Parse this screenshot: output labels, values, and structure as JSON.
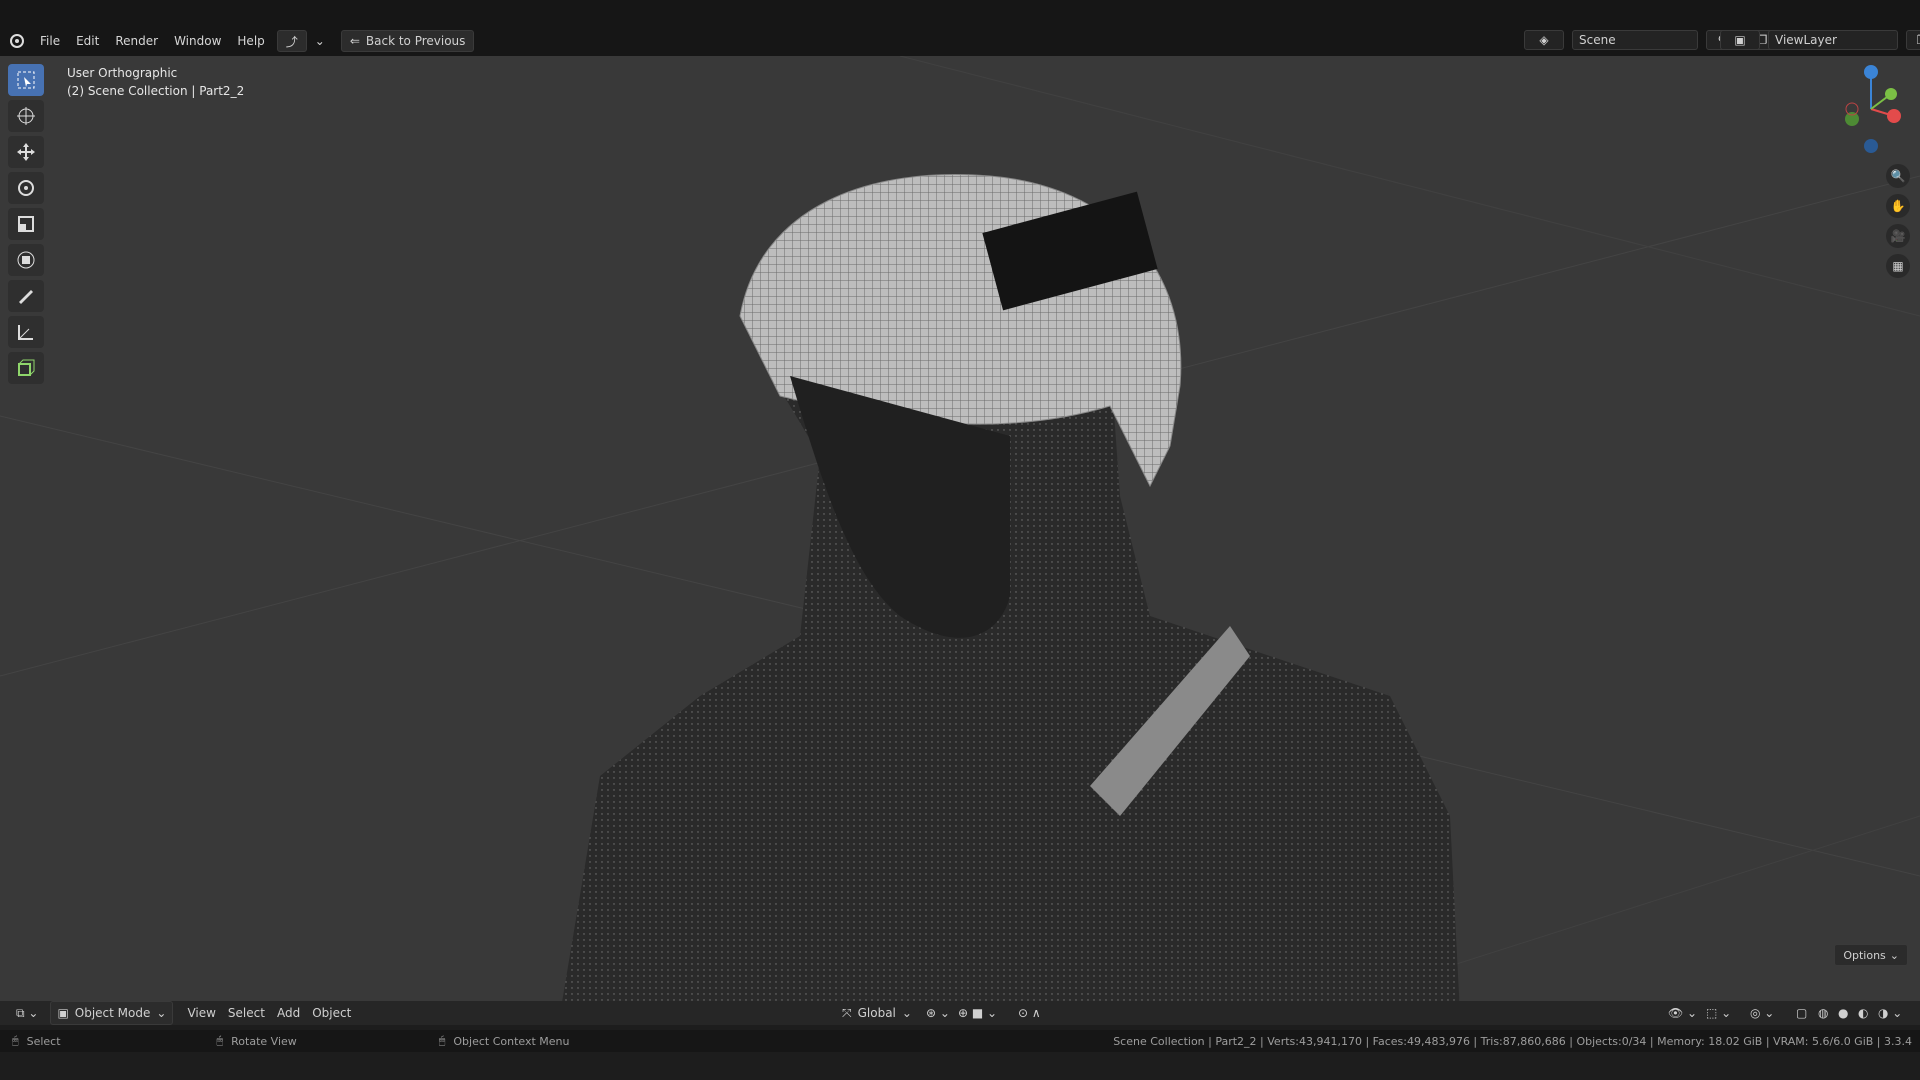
{
  "menubar": {
    "items": [
      "File",
      "Edit",
      "Render",
      "Window",
      "Help"
    ],
    "back_button": "Back to Previous"
  },
  "header": {
    "scene": "Scene",
    "view_layer": "ViewLayer"
  },
  "viewport": {
    "view_name": "User Orthographic",
    "collection": "(2) Scene Collection | Part2_2",
    "options_label": "Options"
  },
  "bottombar": {
    "mode": "Object Mode",
    "menu": [
      "View",
      "Select",
      "Add",
      "Object"
    ],
    "transform_orientation": "Global"
  },
  "status": {
    "select": "Select",
    "rotate": "Rotate View",
    "context": "Object Context Menu",
    "stats": "Scene Collection | Part2_2 | Verts:43,941,170 | Faces:49,483,976 | Tris:87,860,686 | Objects:0/34 | Memory: 18.02 GiB | VRAM: 5.6/6.0 GiB | 3.3.4"
  },
  "colors": {
    "accent": "#4772b3",
    "axis_x": "#e34b4b",
    "axis_y": "#7bbf45",
    "axis_z": "#3b84d6"
  }
}
